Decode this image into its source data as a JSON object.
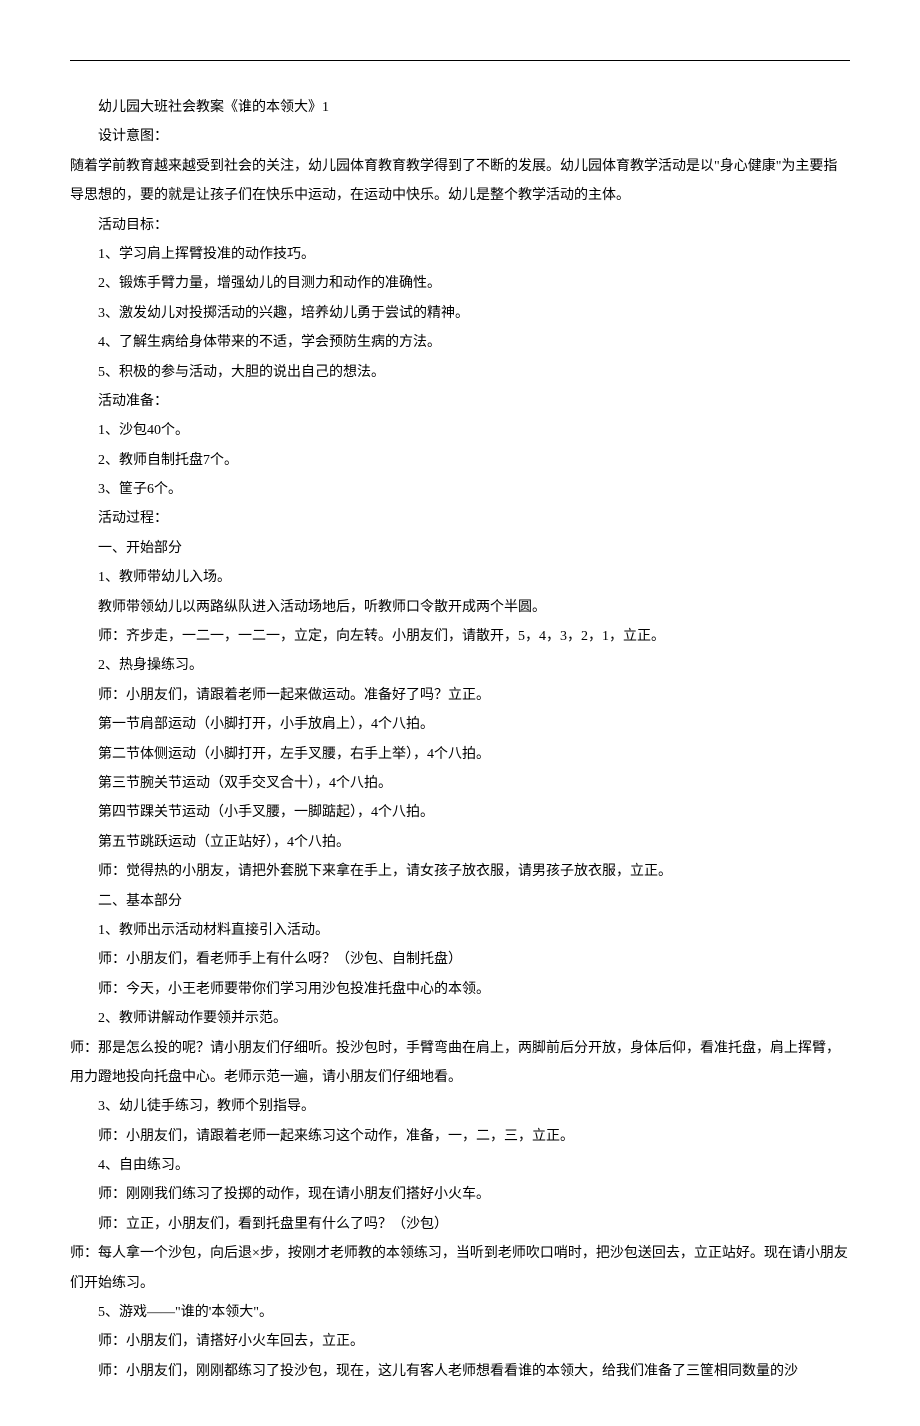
{
  "lines": [
    "幼儿园大班社会教案《谁的本领大》1",
    "设计意图：",
    "随着学前教育越来越受到社会的关注，幼儿园体育教育教学得到了不断的发展。幼儿园体育教学活动是以\"身心健康\"为主要指导思想的，要的就是让孩子们在快乐中运动，在运动中快乐。幼儿是整个教学活动的主体。",
    "活动目标：",
    "1、学习肩上挥臂投准的动作技巧。",
    "2、锻炼手臂力量，增强幼儿的目测力和动作的准确性。",
    "3、激发幼儿对投掷活动的兴趣，培养幼儿勇于尝试的精神。",
    "4、了解生病给身体带来的不适，学会预防生病的方法。",
    "5、积极的参与活动，大胆的说出自己的想法。",
    "活动准备：",
    "1、沙包40个。",
    "2、教师自制托盘7个。",
    "3、筐子6个。",
    "活动过程：",
    "一、开始部分",
    "1、教师带幼儿入场。",
    "教师带领幼儿以两路纵队进入活动场地后，听教师口令散开成两个半圆。",
    "师：齐步走，一二一，一二一，立定，向左转。小朋友们，请散开，5，4，3，2，1，立正。",
    "2、热身操练习。",
    "师：小朋友们，请跟着老师一起来做运动。准备好了吗？立正。",
    "第一节肩部运动（小脚打开，小手放肩上），4个八拍。",
    "第二节体侧运动（小脚打开，左手叉腰，右手上举），4个八拍。",
    "第三节腕关节运动（双手交叉合十），4个八拍。",
    "第四节踝关节运动（小手叉腰，一脚踮起），4个八拍。",
    "第五节跳跃运动（立正站好），4个八拍。",
    "师：觉得热的小朋友，请把外套脱下来拿在手上，请女孩子放衣服，请男孩子放衣服，立正。",
    "二、基本部分",
    "1、教师出示活动材料直接引入活动。",
    "师：小朋友们，看老师手上有什么呀？（沙包、自制托盘）",
    "师：今天，小王老师要带你们学习用沙包投准托盘中心的本领。",
    "2、教师讲解动作要领并示范。",
    "师：那是怎么投的呢？请小朋友们仔细听。投沙包时，手臂弯曲在肩上，两脚前后分开放，身体后仰，看准托盘，肩上挥臂，用力蹬地投向托盘中心。老师示范一遍，请小朋友们仔细地看。",
    "3、幼儿徒手练习，教师个别指导。",
    "师：小朋友们，请跟着老师一起来练习这个动作，准备，一，二，三，立正。",
    "4、自由练习。",
    "师：刚刚我们练习了投掷的动作，现在请小朋友们搭好小火车。",
    "师：立正，小朋友们，看到托盘里有什么了吗？（沙包）",
    "师：每人拿一个沙包，向后退×步，按刚才老师教的本领练习，当听到老师吹口哨时，把沙包送回去，立正站好。现在请小朋友们开始练习。",
    "5、游戏——\"谁的'本领大\"。",
    "师：小朋友们，请搭好小火车回去，立正。",
    "师：小朋友们，刚刚都练习了投沙包，现在，这儿有客人老师想看看谁的本领大，给我们准备了三筐相同数量的沙"
  ],
  "noIndentIndices": [
    2,
    31,
    37
  ]
}
